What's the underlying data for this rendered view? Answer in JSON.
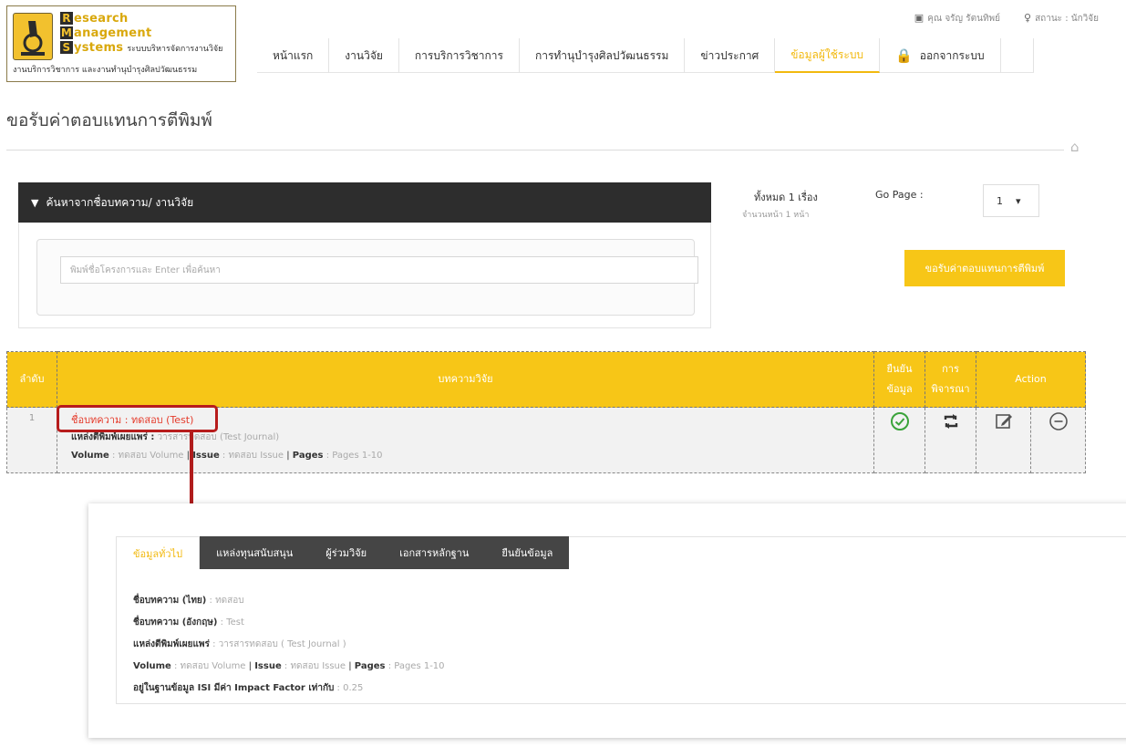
{
  "logo": {
    "line1": "esearch",
    "line2": "anagement",
    "line3": "ystems",
    "cap1": "R",
    "cap2": "M",
    "cap3": "S",
    "sub": "ระบบบริหารจัดการงานวิจัย",
    "footer": "งานบริการวิชาการ และงานทำนุบำรุงศิลปวัฒนธรรม"
  },
  "user": {
    "name": "คุณ จรัญ รัตนทิพย์",
    "status": "สถานะ : นักวิจัย"
  },
  "nav": [
    "หน้าแรก",
    "งานวิจัย",
    "การบริการวิชาการ",
    "การทำนุบำรุงศิลปวัฒนธรรม",
    "ข่าวประกาศ",
    "ข้อมูลผู้ใช้ระบบ",
    "ออกจากระบบ"
  ],
  "page_title": "ขอรับค่าตอบแทนการตีพิมพ์",
  "search": {
    "header": "ค้นหาจากชื่อบทความ/ งานวิจัย",
    "placeholder": "พิมพ์ชื่อโครงการและ Enter เพื่อค้นหา"
  },
  "summary": {
    "total": "ทั้งหมด 1 เรื่อง",
    "pages": "จำนวนหน้า 1 หน้า",
    "go_page_label": "Go Page :",
    "go_page_value": "1"
  },
  "request_button": "ขอรับค่าตอบแทนการตีพิมพ์",
  "table": {
    "headers": {
      "no": "ลำดับ",
      "article": "บทความวิจัย",
      "confirm_1": "ยืนยัน",
      "confirm_2": "ข้อมูล",
      "review_1": "การ",
      "review_2": "พิจารณา",
      "action": "Action"
    },
    "rows": [
      {
        "no": "1",
        "title": "ชื่อบทความ : ทดสอบ (Test)",
        "source_label": "แหล่งตีพิมพ์เผยแพร่ :",
        "source_value": "วารสารทดสอบ (Test Journal)",
        "volume_label": "Volume",
        "volume_value": ": ทดสอบ Volume",
        "issue_label": "Issue",
        "issue_value": ": ทดสอบ Issue",
        "pages_label": "Pages",
        "pages_value": ": Pages 1-10"
      }
    ]
  },
  "detail": {
    "tabs": [
      "ข้อมูลทั่วไป",
      "แหล่งทุนสนับสนุน",
      "ผู้ร่วมวิจัย",
      "เอกสารหลักฐาน",
      "ยืนยันข้อมูล"
    ],
    "fields": {
      "title_th_label": "ชื่อบทความ (ไทย)",
      "title_th_value": ": ทดสอบ",
      "title_en_label": "ชื่อบทความ (อังกฤษ)",
      "title_en_value": ": Test",
      "source_label": "แหล่งตีพิมพ์เผยแพร่",
      "source_value": ": วารสารทดสอบ ( Test Journal )",
      "volume_label": "Volume",
      "volume_value": ": ทดสอบ Volume",
      "issue_label": "Issue",
      "issue_value": ": ทดสอบ Issue",
      "pages_label": "Pages",
      "pages_value": ": Pages 1-10",
      "isi_label": "อยู่ในฐานข้อมูล ISI มีค่า Impact Factor เท่ากับ",
      "isi_value": ": 0.25"
    }
  },
  "colors": {
    "accent": "#f7c617",
    "highlight": "#b71c1c",
    "confirm": "#3aa33a"
  }
}
